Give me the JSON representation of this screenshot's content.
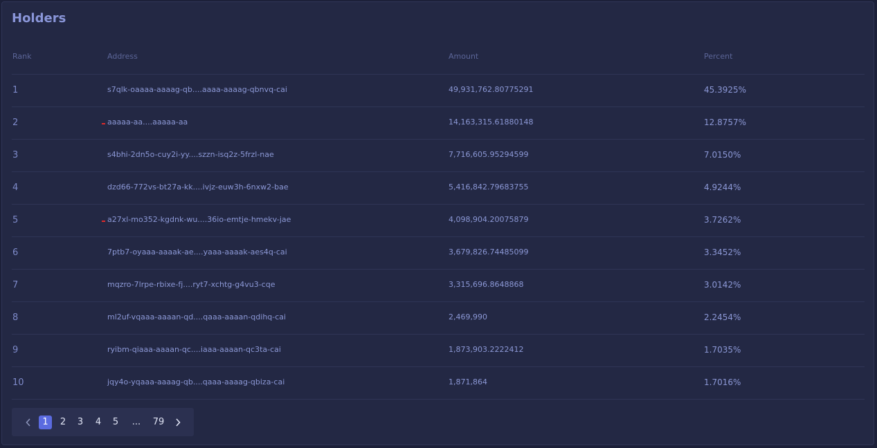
{
  "title": "Holders",
  "columns": {
    "rank": "Rank",
    "address": "Address",
    "amount": "Amount",
    "percent": "Percent"
  },
  "rows": [
    {
      "rank": "1",
      "address": "s7qlk-oaaaa-aaaag-qb....aaaa-aaaag-qbnvq-cai",
      "amount": "49,931,762.80775291",
      "percent": "45.3925%",
      "flag": false
    },
    {
      "rank": "2",
      "address": "aaaaa-aa....aaaaa-aa",
      "amount": "14,163,315.61880148",
      "percent": "12.8757%",
      "flag": true
    },
    {
      "rank": "3",
      "address": "s4bhi-2dn5o-cuy2i-yy....szzn-isq2z-5frzl-nae",
      "amount": "7,716,605.95294599",
      "percent": "7.0150%",
      "flag": false
    },
    {
      "rank": "4",
      "address": "dzd66-772vs-bt27a-kk....ivjz-euw3h-6nxw2-bae",
      "amount": "5,416,842.79683755",
      "percent": "4.9244%",
      "flag": false
    },
    {
      "rank": "5",
      "address": "a27xl-mo352-kgdnk-wu....36io-emtje-hmekv-jae",
      "amount": "4,098,904.20075879",
      "percent": "3.7262%",
      "flag": true
    },
    {
      "rank": "6",
      "address": "7ptb7-oyaaa-aaaak-ae....yaaa-aaaak-aes4q-cai",
      "amount": "3,679,826.74485099",
      "percent": "3.3452%",
      "flag": false
    },
    {
      "rank": "7",
      "address": "mqzro-7lrpe-rbixe-fj....ryt7-xchtg-g4vu3-cqe",
      "amount": "3,315,696.8648868",
      "percent": "3.0142%",
      "flag": false
    },
    {
      "rank": "8",
      "address": "ml2uf-vqaaa-aaaan-qd....qaaa-aaaan-qdihq-cai",
      "amount": "2,469,990",
      "percent": "2.2454%",
      "flag": false
    },
    {
      "rank": "9",
      "address": "ryibm-qiaaa-aaaan-qc....iaaa-aaaan-qc3ta-cai",
      "amount": "1,873,903.2222412",
      "percent": "1.7035%",
      "flag": false
    },
    {
      "rank": "10",
      "address": "jqy4o-yqaaa-aaaag-qb....qaaa-aaaag-qbiza-cai",
      "amount": "1,871,864",
      "percent": "1.7016%",
      "flag": false
    }
  ],
  "pagination": {
    "prev_icon": "chevron-left-icon",
    "next_icon": "chevron-right-icon",
    "pages": [
      "1",
      "2",
      "3",
      "4",
      "5",
      "...",
      "79"
    ],
    "current": "1"
  },
  "colors": {
    "background": "#232844",
    "accent": "#5b6be0",
    "title": "#8a96d9",
    "flag": "#e02a2a"
  }
}
